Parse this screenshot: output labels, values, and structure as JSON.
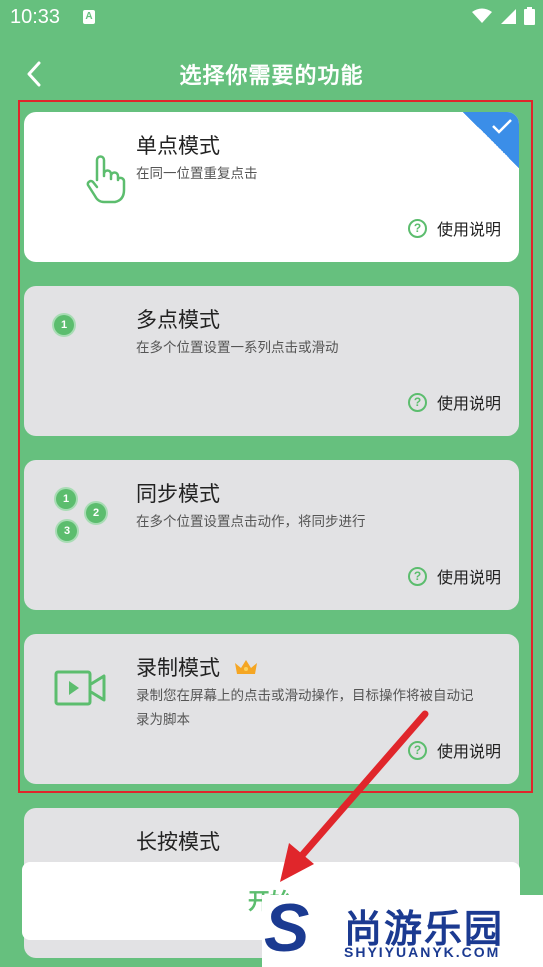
{
  "status_bar": {
    "time": "10:33",
    "notification_glyph": "A",
    "icons": [
      "wifi-icon",
      "signal-icon",
      "battery-icon"
    ]
  },
  "header": {
    "title": "选择你需要的功能"
  },
  "modes": [
    {
      "name": "单点模式",
      "desc": "在同一位置重复点击",
      "help": "使用说明",
      "selected": true
    },
    {
      "name": "多点模式",
      "desc": "在多个位置设置一系列点击或滑动",
      "help": "使用说明",
      "num1": "1"
    },
    {
      "name": "同步模式",
      "desc": "在多个位置设置点击动作，将同步进行",
      "help": "使用说明",
      "n1": "1",
      "n2": "2",
      "n3": "3"
    },
    {
      "name": "录制模式",
      "desc": "录制您在屏幕上的点击或滑动操作，目标操作将被自动记录为脚本",
      "help": "使用说明",
      "premium": true
    },
    {
      "name": "长按模式"
    }
  ],
  "start_button": {
    "label": "开始"
  },
  "watermark": {
    "logo_letter": "S",
    "text": "尚游乐园",
    "url": "SHYIYUANYK.COM"
  },
  "colors": {
    "background": "#66c07e",
    "accent": "#5cbd6e",
    "selected_corner": "#3b8ee8",
    "highlight_frame": "#e0262b",
    "card": "#e2e2e4"
  }
}
